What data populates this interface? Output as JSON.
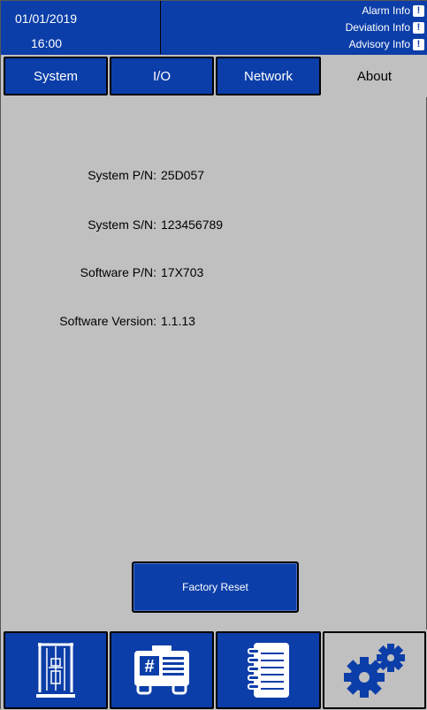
{
  "header": {
    "date": "01/01/2019",
    "time": "16:00",
    "alarm_label": "Alarm Info",
    "deviation_label": "Deviation Info",
    "advisory_label": "Advisory Info",
    "alert_glyph": "!"
  },
  "tabs": [
    {
      "label": "System",
      "active": false
    },
    {
      "label": "I/O",
      "active": false
    },
    {
      "label": "Network",
      "active": false
    },
    {
      "label": "About",
      "active": true
    }
  ],
  "about": {
    "system_pn_label": "System P/N:",
    "system_pn_value": "25D057",
    "system_sn_label": "System S/N:",
    "system_sn_value": "123456789",
    "software_pn_label": "Software P/N:",
    "software_pn_value": "17X703",
    "software_version_label": "Software Version:",
    "software_version_value": "1.1.13"
  },
  "factory_reset_label": "Factory Reset",
  "nav": [
    {
      "icon": "test-stand-icon",
      "active": false
    },
    {
      "icon": "machine-id-icon",
      "active": false
    },
    {
      "icon": "notebook-icon",
      "active": false
    },
    {
      "icon": "gears-icon",
      "active": true
    }
  ],
  "colors": {
    "primary": "#0b3ea8",
    "background": "#c0c0c0",
    "text_on_primary": "#ffffff"
  }
}
